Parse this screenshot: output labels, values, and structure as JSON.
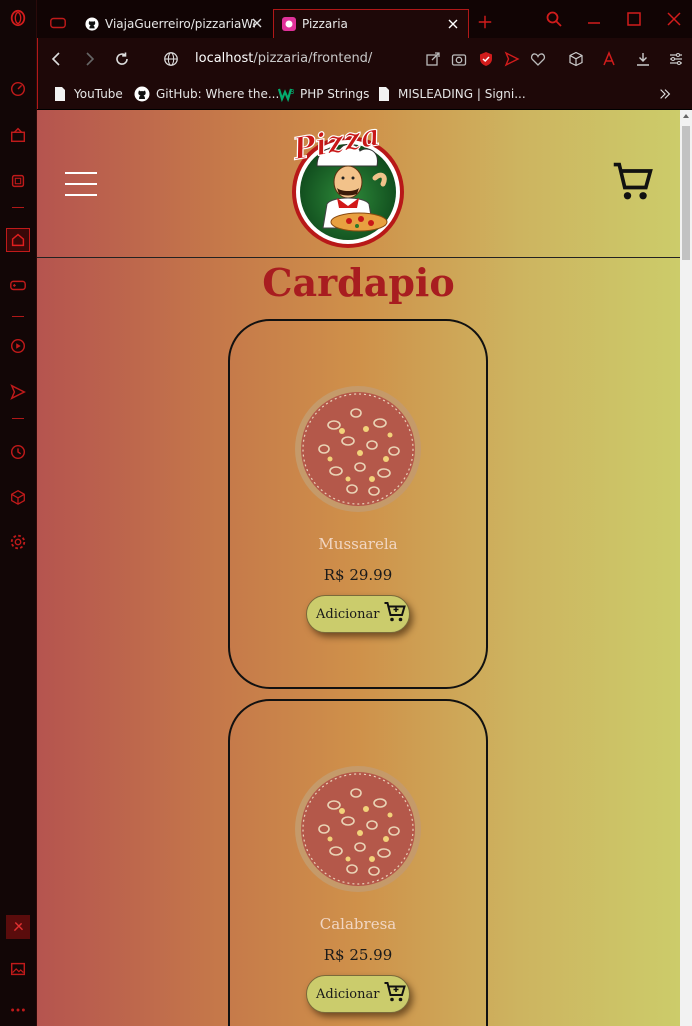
{
  "browser": {
    "tabs": [
      {
        "label": "ViajaGuerreiro/pizzariaWeb",
        "icon": "github-icon"
      },
      {
        "label": "Pizzaria",
        "icon": "pizzaria-favicon-icon"
      }
    ],
    "url_host": "localhost",
    "url_path": "/pizzaria/frontend/",
    "bookmarks": [
      {
        "label": "YouTube",
        "icon": "file-icon"
      },
      {
        "label": "GitHub: Where the...",
        "icon": "github-icon"
      },
      {
        "label": "PHP Strings",
        "icon": "w3schools-icon"
      },
      {
        "label": "MISLEADING | Signi...",
        "icon": "file-icon"
      }
    ],
    "accent": "#b01818"
  },
  "page": {
    "logo_text": "Pizza",
    "title": "Cardapio",
    "products": [
      {
        "name": "Mussarela",
        "price": "R$ 29.99",
        "button": "Adicionar"
      },
      {
        "name": "Calabresa",
        "price": "R$ 25.99",
        "button": "Adicionar"
      }
    ]
  }
}
